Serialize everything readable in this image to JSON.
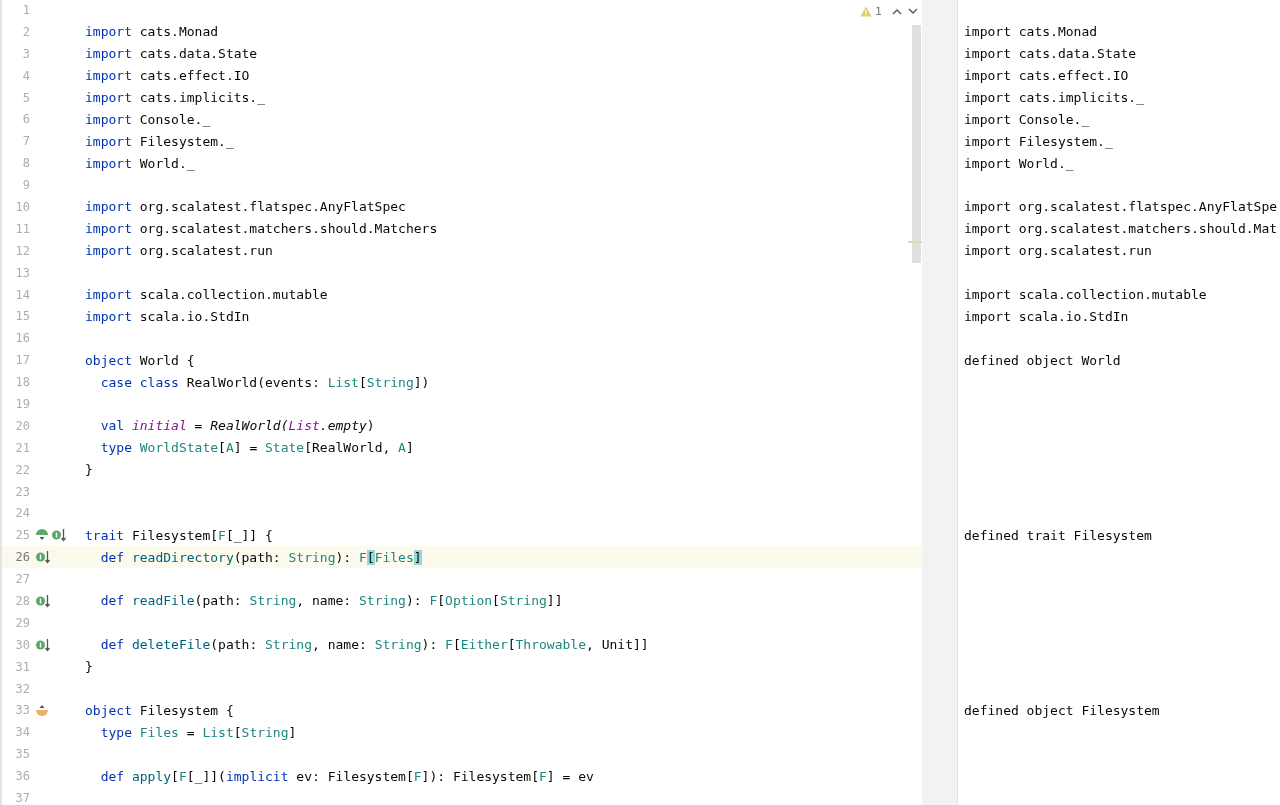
{
  "editor": {
    "problems": {
      "count": "1"
    },
    "lines": [
      {
        "number": "1"
      },
      {
        "number": "2",
        "tokens": [
          {
            "text": "import",
            "kind": "keyword"
          },
          {
            "text": " cats.Monad",
            "kind": "plain"
          }
        ],
        "output": "import cats.Monad"
      },
      {
        "number": "3",
        "tokens": [
          {
            "text": "import",
            "kind": "keyword"
          },
          {
            "text": " cats.data.State",
            "kind": "plain"
          }
        ],
        "output": "import cats.data.State"
      },
      {
        "number": "4",
        "tokens": [
          {
            "text": "import",
            "kind": "keyword"
          },
          {
            "text": " cats.effect.IO",
            "kind": "plain"
          }
        ],
        "output": "import cats.effect.IO"
      },
      {
        "number": "5",
        "tokens": [
          {
            "text": "import",
            "kind": "keyword"
          },
          {
            "text": " cats.implicits._",
            "kind": "plain"
          }
        ],
        "output": "import cats.implicits._"
      },
      {
        "number": "6",
        "tokens": [
          {
            "text": "import",
            "kind": "keyword"
          },
          {
            "text": " Console._",
            "kind": "plain"
          }
        ],
        "output": "import Console._"
      },
      {
        "number": "7",
        "tokens": [
          {
            "text": "import",
            "kind": "keyword"
          },
          {
            "text": " Filesystem._",
            "kind": "plain"
          }
        ],
        "output": "import Filesystem._"
      },
      {
        "number": "8",
        "tokens": [
          {
            "text": "import",
            "kind": "keyword"
          },
          {
            "text": " World._",
            "kind": "plain"
          }
        ],
        "output": "import World._"
      },
      {
        "number": "9"
      },
      {
        "number": "10",
        "tokens": [
          {
            "text": "import",
            "kind": "keyword"
          },
          {
            "text": " org.scalatest.flatspec.AnyFlatSpec",
            "kind": "plain"
          }
        ],
        "output": "import org.scalatest.flatspec.AnyFlatSpe"
      },
      {
        "number": "11",
        "tokens": [
          {
            "text": "import",
            "kind": "keyword"
          },
          {
            "text": " org.scalatest.matchers.should.Matchers",
            "kind": "plain"
          }
        ],
        "output": "import org.scalatest.matchers.should.Mat"
      },
      {
        "number": "12",
        "tokens": [
          {
            "text": "import",
            "kind": "keyword"
          },
          {
            "text": " org.scalatest.run",
            "kind": "plain"
          }
        ],
        "output": "import org.scalatest.run"
      },
      {
        "number": "13"
      },
      {
        "number": "14",
        "tokens": [
          {
            "text": "import",
            "kind": "keyword"
          },
          {
            "text": " scala.collection.mutable",
            "kind": "plain"
          }
        ],
        "output": "import scala.collection.mutable"
      },
      {
        "number": "15",
        "tokens": [
          {
            "text": "import",
            "kind": "keyword"
          },
          {
            "text": " scala.io.StdIn",
            "kind": "plain"
          }
        ],
        "output": "import scala.io.StdIn"
      },
      {
        "number": "16"
      },
      {
        "number": "17",
        "tokens": [
          {
            "text": "object",
            "kind": "keyword"
          },
          {
            "text": " World {",
            "kind": "plain"
          }
        ],
        "output": "defined object World"
      },
      {
        "number": "18",
        "tokens": [
          {
            "text": "  case class",
            "kind": "keyword"
          },
          {
            "text": " RealWorld(events: ",
            "kind": "plain"
          },
          {
            "text": "List",
            "kind": "type"
          },
          {
            "text": "[",
            "kind": "plain"
          },
          {
            "text": "String",
            "kind": "type"
          },
          {
            "text": "])",
            "kind": "plain"
          }
        ]
      },
      {
        "number": "19"
      },
      {
        "number": "20",
        "tokens": [
          {
            "text": "  val ",
            "kind": "keyword"
          },
          {
            "text": "initial",
            "kind": "field"
          },
          {
            "text": " = ",
            "kind": "plain"
          },
          {
            "text": "RealWorld(",
            "kind": "italic"
          },
          {
            "text": "List",
            "kind": "field"
          },
          {
            "text": ".empty",
            "kind": "italic"
          },
          {
            "text": ")",
            "kind": "plain"
          }
        ]
      },
      {
        "number": "21",
        "tokens": [
          {
            "text": "  type ",
            "kind": "keyword"
          },
          {
            "text": "WorldState",
            "kind": "type"
          },
          {
            "text": "[",
            "kind": "plain"
          },
          {
            "text": "A",
            "kind": "type"
          },
          {
            "text": "] = ",
            "kind": "plain"
          },
          {
            "text": "State",
            "kind": "type"
          },
          {
            "text": "[RealWorld, ",
            "kind": "plain"
          },
          {
            "text": "A",
            "kind": "type"
          },
          {
            "text": "]",
            "kind": "plain"
          }
        ]
      },
      {
        "number": "22",
        "tokens": [
          {
            "text": "}",
            "kind": "plain"
          }
        ]
      },
      {
        "number": "23"
      },
      {
        "number": "24"
      },
      {
        "number": "25",
        "gutter": [
          {
            "kind": "fold"
          },
          {
            "kind": "implemented"
          }
        ],
        "tokens": [
          {
            "text": "trait",
            "kind": "keyword"
          },
          {
            "text": " Filesystem[",
            "kind": "plain"
          },
          {
            "text": "F",
            "kind": "type"
          },
          {
            "text": "[_]] {",
            "kind": "plain"
          }
        ],
        "output": "defined trait Filesystem"
      },
      {
        "number": "26",
        "current": true,
        "gutter": [
          {
            "kind": "implemented"
          }
        ],
        "tokens": [
          {
            "text": "  def ",
            "kind": "keyword"
          },
          {
            "text": "readDirectory",
            "kind": "method"
          },
          {
            "text": "(path: ",
            "kind": "plain"
          },
          {
            "text": "String",
            "kind": "type"
          },
          {
            "text": "): ",
            "kind": "plain"
          },
          {
            "text": "F",
            "kind": "type"
          },
          {
            "text": "[",
            "kind": "match"
          },
          {
            "text": "Files",
            "kind": "type"
          },
          {
            "text": "]",
            "kind": "match"
          }
        ]
      },
      {
        "number": "27"
      },
      {
        "number": "28",
        "gutter": [
          {
            "kind": "implemented"
          }
        ],
        "tokens": [
          {
            "text": "  def ",
            "kind": "keyword"
          },
          {
            "text": "readFile",
            "kind": "method"
          },
          {
            "text": "(path: ",
            "kind": "plain"
          },
          {
            "text": "String",
            "kind": "type"
          },
          {
            "text": ", name: ",
            "kind": "plain"
          },
          {
            "text": "String",
            "kind": "type"
          },
          {
            "text": "): ",
            "kind": "plain"
          },
          {
            "text": "F",
            "kind": "type"
          },
          {
            "text": "[",
            "kind": "plain"
          },
          {
            "text": "Option",
            "kind": "type"
          },
          {
            "text": "[",
            "kind": "plain"
          },
          {
            "text": "String",
            "kind": "type"
          },
          {
            "text": "]]",
            "kind": "plain"
          }
        ]
      },
      {
        "number": "29"
      },
      {
        "number": "30",
        "gutter": [
          {
            "kind": "implemented"
          }
        ],
        "tokens": [
          {
            "text": "  def ",
            "kind": "keyword"
          },
          {
            "text": "deleteFile",
            "kind": "method"
          },
          {
            "text": "(path: ",
            "kind": "plain"
          },
          {
            "text": "String",
            "kind": "type"
          },
          {
            "text": ", name: ",
            "kind": "plain"
          },
          {
            "text": "String",
            "kind": "type"
          },
          {
            "text": "): ",
            "kind": "plain"
          },
          {
            "text": "F",
            "kind": "type"
          },
          {
            "text": "[",
            "kind": "plain"
          },
          {
            "text": "Either",
            "kind": "type"
          },
          {
            "text": "[",
            "kind": "plain"
          },
          {
            "text": "Throwable",
            "kind": "type"
          },
          {
            "text": ", Unit]]",
            "kind": "plain"
          }
        ]
      },
      {
        "number": "31",
        "tokens": [
          {
            "text": "}",
            "kind": "plain"
          }
        ]
      },
      {
        "number": "32"
      },
      {
        "number": "33",
        "gutter": [
          {
            "kind": "companion"
          }
        ],
        "tokens": [
          {
            "text": "object",
            "kind": "keyword"
          },
          {
            "text": " Filesystem {",
            "kind": "plain"
          }
        ],
        "output": "defined object Filesystem"
      },
      {
        "number": "34",
        "tokens": [
          {
            "text": "  type ",
            "kind": "keyword"
          },
          {
            "text": "Files",
            "kind": "type"
          },
          {
            "text": " = ",
            "kind": "plain"
          },
          {
            "text": "List",
            "kind": "type"
          },
          {
            "text": "[",
            "kind": "plain"
          },
          {
            "text": "String",
            "kind": "type"
          },
          {
            "text": "]",
            "kind": "plain"
          }
        ]
      },
      {
        "number": "35"
      },
      {
        "number": "36",
        "tokens": [
          {
            "text": "  def ",
            "kind": "keyword"
          },
          {
            "text": "apply",
            "kind": "method"
          },
          {
            "text": "[",
            "kind": "plain"
          },
          {
            "text": "F",
            "kind": "type"
          },
          {
            "text": "[_]](",
            "kind": "plain"
          },
          {
            "text": "implicit",
            "kind": "keyword"
          },
          {
            "text": " ev: Filesystem[",
            "kind": "plain"
          },
          {
            "text": "F",
            "kind": "type"
          },
          {
            "text": "]): Filesystem[",
            "kind": "plain"
          },
          {
            "text": "F",
            "kind": "type"
          },
          {
            "text": "] = ev",
            "kind": "plain"
          }
        ]
      },
      {
        "number": "37"
      }
    ]
  }
}
